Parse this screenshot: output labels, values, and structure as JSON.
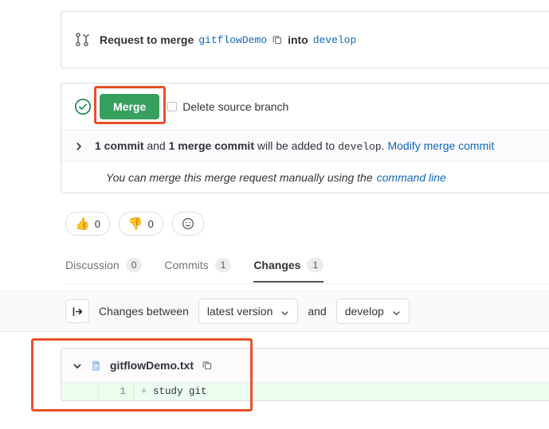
{
  "merge_request": {
    "icon": "merge-request-icon",
    "title_prefix": "Request to merge",
    "source_branch": "gitflowDemo",
    "copy_icon": "copy-icon",
    "into_word": "into",
    "target_branch": "develop"
  },
  "merge_widget": {
    "status_icon": "status-success-check-icon",
    "merge_button": "Merge",
    "delete_source_branch_label": "Delete source branch",
    "delete_source_branch_checked": false,
    "expand_icon": "chevron-right-icon",
    "commits_count_text": "1 commit",
    "and_word": "and",
    "merge_commit_text": "1 merge commit",
    "will_be_added_text": "will be added to",
    "target_branch": "develop",
    "added_suffix": ".",
    "modify_merge_commit_link": "Modify merge commit",
    "manual_merge_text": "You can merge this merge request manually using the",
    "command_line_link": "command line"
  },
  "reactions": [
    {
      "name": "thumbsup",
      "emoji": "👍",
      "count": "0"
    },
    {
      "name": "thumbsdown",
      "emoji": "👎",
      "count": "0"
    }
  ],
  "add_reaction": {
    "icon": "smiley-add-reaction-icon"
  },
  "tabs": [
    {
      "id": "discussion",
      "label": "Discussion",
      "count": "0",
      "active": false
    },
    {
      "id": "commits",
      "label": "Commits",
      "count": "1",
      "active": false
    },
    {
      "id": "changes",
      "label": "Changes",
      "count": "1",
      "active": true
    }
  ],
  "changes_bar": {
    "toggle_icon": "arrow-right-to-line-icon",
    "label": "Changes between",
    "version_dropdown": "latest version",
    "and_word": "and",
    "branch_dropdown": "develop"
  },
  "file_diff": {
    "collapse_icon": "chevron-down-icon",
    "file_icon": "document-icon",
    "file_name": "gitflowDemo.txt",
    "copy_path_icon": "copy-icon",
    "lines": [
      {
        "old_number": "",
        "new_number": "1",
        "sign": "+",
        "text": "study git",
        "type": "added"
      }
    ]
  },
  "colors": {
    "accent_link": "#1068bf",
    "merge_green": "#37a05f",
    "status_green": "#108548",
    "annotation_orange": "#e8502b",
    "diff_added_bg": "#ecfdf0"
  }
}
